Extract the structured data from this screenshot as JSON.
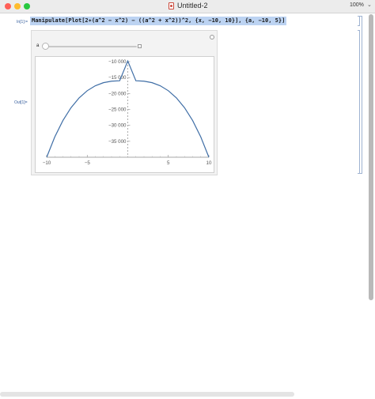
{
  "window": {
    "title": "Untitled-2",
    "zoom": "100%"
  },
  "cell": {
    "in_label": "In[1]:=",
    "out_label": "Out[1]=",
    "input_code": "Manipulate[Plot[2∗(a^2 − x^2) − ((a^2 + x^2))^2, {x, −10, 10}], {a, −10, 5}]"
  },
  "manipulate": {
    "slider": {
      "label": "a",
      "min": -10,
      "max": 5,
      "value": -10
    }
  },
  "chart_data": {
    "type": "line",
    "title": "",
    "xlabel": "",
    "ylabel": "",
    "xlim": [
      -10,
      10
    ],
    "ylim": [
      -40000,
      -10000
    ],
    "x_ticks": [
      -10,
      -5,
      5,
      10
    ],
    "x_tick_labels": [
      "−10",
      "−5",
      "5",
      "10"
    ],
    "y_ticks": [
      -10000,
      -15000,
      -20000,
      -25000,
      -30000,
      -35000
    ],
    "y_tick_labels": [
      "−10 000",
      "−15 000",
      "−20 000",
      "−25 000",
      "−30 000",
      "−35 000"
    ],
    "series": [
      {
        "color": "#3f6ea6",
        "x": [
          -10,
          -9,
          -8,
          -7,
          -6,
          -5,
          -4,
          -3,
          -2,
          -1,
          0,
          1,
          2,
          3,
          4,
          5,
          6,
          7,
          8,
          9,
          10
        ],
        "y": [
          -40000,
          -33624,
          -28496,
          -24464,
          -21384,
          -19125,
          -17568,
          -16604,
          -16136,
          -16004,
          -9800,
          -16004,
          -16136,
          -16604,
          -17568,
          -19125,
          -21384,
          -24464,
          -28496,
          -33624,
          -40000
        ]
      }
    ]
  }
}
